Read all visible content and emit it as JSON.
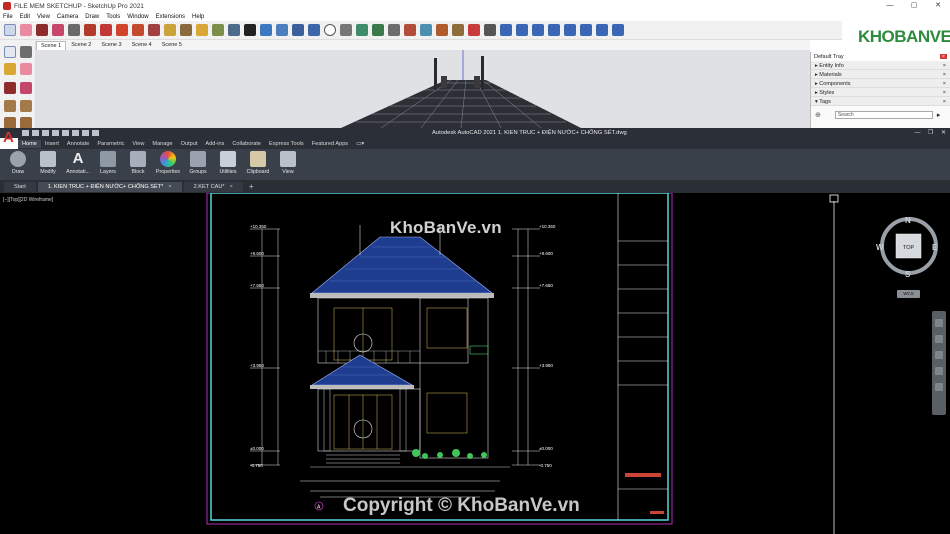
{
  "sketchup": {
    "window_title": "FILE MEM SKETCHUP - SketchUp Pro 2021",
    "menu": [
      "File",
      "Edit",
      "View",
      "Camera",
      "Draw",
      "Tools",
      "Window",
      "Extensions",
      "Help"
    ],
    "scenes": [
      "Scene 1",
      "Scene 2",
      "Scene 3",
      "Scene 4",
      "Scene 5"
    ],
    "tray": {
      "title": "Default Tray",
      "items": [
        "Entity Info",
        "Materials",
        "Components",
        "Styles",
        "Tags"
      ],
      "search_placeholder": "Search"
    },
    "logo_text": "KHOBANVE"
  },
  "autocad": {
    "window_title": "Autodesk AutoCAD 2021    1. KIEN TRUC + ĐIỆN NƯỚC+ CHỐNG SÉT.dwg",
    "logo_letter": "A",
    "ribbon_tabs": [
      "Home",
      "Insert",
      "Annotate",
      "Parametric",
      "View",
      "Manage",
      "Output",
      "Add-ins",
      "Collaborate",
      "Express Tools",
      "Featured Apps"
    ],
    "ribbon_panels": [
      "Draw",
      "Modify",
      "Annotati...",
      "Layers",
      "Block",
      "Properties",
      "Groups",
      "Utilities",
      "Clipboard",
      "View"
    ],
    "doc_tabs": [
      {
        "label": "Start"
      },
      {
        "label": "1. KIEN TRUC + ĐIỆN NƯỚC+ CHỐNG SÉT*",
        "close": "×"
      },
      {
        "label": "2.KET CAU*",
        "close": "×"
      }
    ],
    "new_tab_symbol": "+",
    "viewport_label": "[−][Top][2D Wireframe]",
    "viewcube": {
      "top": "TOP",
      "n": "N",
      "s": "S",
      "e": "E",
      "w": "W",
      "wcs": "WCS"
    },
    "drawing": {
      "elevation_marks": [
        "+10.350",
        "+9.600",
        "+7.650",
        "+3.950",
        "±0.000",
        "-0.750"
      ],
      "section_bubble": "A"
    }
  },
  "watermarks": {
    "top": "KhoBanVe.vn",
    "bottom": "Copyright © KhoBanVe.vn"
  },
  "colors": {
    "autocad_dark": "#2b2f37",
    "ribbon": "#3a4049",
    "roof_blue": "#1f3d8f",
    "cad_cyan": "#58d3e0",
    "cad_magenta": "#b22fb2",
    "brand_green": "#2e8b3e"
  }
}
